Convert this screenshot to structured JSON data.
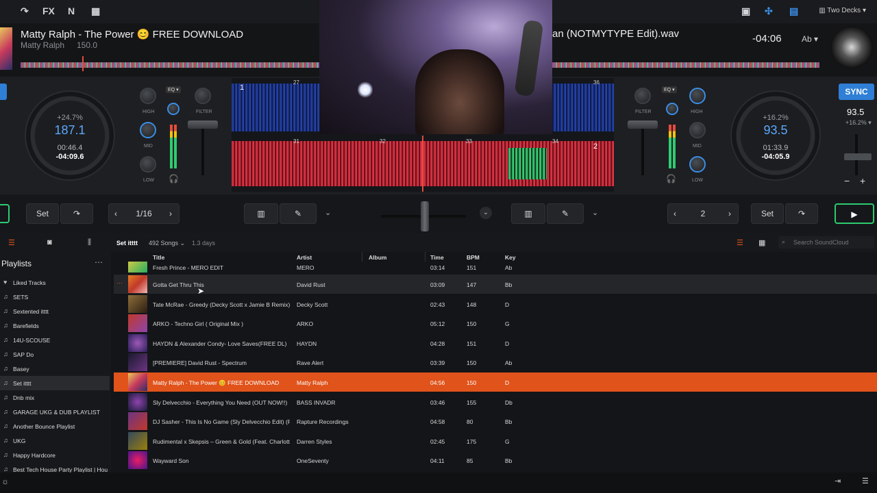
{
  "topbar": {
    "fx": "FX",
    "two_decks": "Two Decks"
  },
  "deck_a": {
    "title": "Matty Ralph - The Power 😊 FREE DOWNLOAD",
    "artist": "Matty Ralph",
    "bpm_text": "150.0",
    "pitch": "+24.7%",
    "bpm": "187.1",
    "elapsed": "00:46.4",
    "remaining": "-04:09.6",
    "beat_page": "1/16",
    "set_label": "Set",
    "waveform_beat": "1"
  },
  "deck_b": {
    "title": "an (NOTMYTYPE Edit).wav",
    "remaining_top": "-04:06",
    "key": "Ab",
    "sync": "SYNC",
    "bpm_top": "93.5",
    "pitch_top": "+16.2%",
    "pitch": "+16.2%",
    "bpm": "93.5",
    "elapsed": "01:33.9",
    "remaining": "-04:05.9",
    "beat_page": "2",
    "set_label": "Set",
    "waveform_beat": "2"
  },
  "mixer": {
    "eq": "EQ",
    "high": "HIGH",
    "mid": "MID",
    "low": "LOW",
    "filter": "FILTER"
  },
  "waveform_ticks": [
    "27",
    "31",
    "32",
    "33",
    "34",
    "36"
  ],
  "library": {
    "playlist_name": "Set itttt",
    "song_count": "492 Songs",
    "duration": "1.3 days",
    "search_placeholder": "Search SoundCloud",
    "sidebar_title": "Playlists",
    "sidebar_items": [
      "Liked Tracks",
      "SETS",
      "Sextented itttt",
      "Barefields",
      "14U-SCOUSE",
      "SAP Do",
      "Basey",
      "Set itttt",
      "Dnb mix",
      "GARAGE UKG & DUB PLAYLIST",
      "Another Bounce Playlist",
      "UKG",
      "Happy Hardcore",
      "Best Tech House Party Playlist | Hou"
    ],
    "columns": {
      "title": "Title",
      "artist": "Artist",
      "album": "Album",
      "time": "Time",
      "bpm": "BPM",
      "key": "Key"
    },
    "rows": [
      {
        "title": "Fresh Prince - MERO EDIT",
        "artist": "MERO",
        "time": "03:14",
        "bpm": "151",
        "key": "Ab"
      },
      {
        "title": "Gotta Get Thru This",
        "artist": "David Rust",
        "time": "03:09",
        "bpm": "147",
        "key": "Bb"
      },
      {
        "title": "Tate McRae - Greedy (Decky Scott x Jamie B Remix) (...",
        "artist": "Decky Scott",
        "time": "02:43",
        "bpm": "148",
        "key": "D"
      },
      {
        "title": "ARKO - Techno Girl ( Original Mix )",
        "artist": "ARKO",
        "time": "05:12",
        "bpm": "150",
        "key": "G"
      },
      {
        "title": "HAYDN & Alexander Condy- Love Saves(FREE DL)",
        "artist": "HAYDN",
        "time": "04:28",
        "bpm": "151",
        "key": "D"
      },
      {
        "title": "[PREMIERE] David Rust - Spectrum",
        "artist": "Rave Alert",
        "time": "03:39",
        "bpm": "150",
        "key": "Ab"
      },
      {
        "title": "Matty Ralph - The Power 😊 FREE DOWNLOAD",
        "artist": "Matty Ralph",
        "time": "04:56",
        "bpm": "150",
        "key": "D"
      },
      {
        "title": "Sly Delvecchio - Everything You Need (OUT NOW!!)",
        "artist": "BASS INVADR",
        "time": "03:46",
        "bpm": "155",
        "key": "Db"
      },
      {
        "title": "DJ Sasher - This Is No Game (Sly Delvecchio Edit) (Fre...",
        "artist": "Rapture Recordings",
        "time": "04:58",
        "bpm": "80",
        "key": "Bb"
      },
      {
        "title": "Rudimental x Skepsis – Green & Gold (Feat. Charlotte...",
        "artist": "Darren Styles",
        "time": "02:45",
        "bpm": "175",
        "key": "G"
      },
      {
        "title": "Wayward Son",
        "artist": "OneSeventy",
        "time": "04:11",
        "bpm": "85",
        "key": "Bb"
      }
    ]
  },
  "colors": {
    "accent_orange": "#e0531b",
    "accent_blue": "#2f7fd6",
    "play_green": "#2ecc71"
  }
}
